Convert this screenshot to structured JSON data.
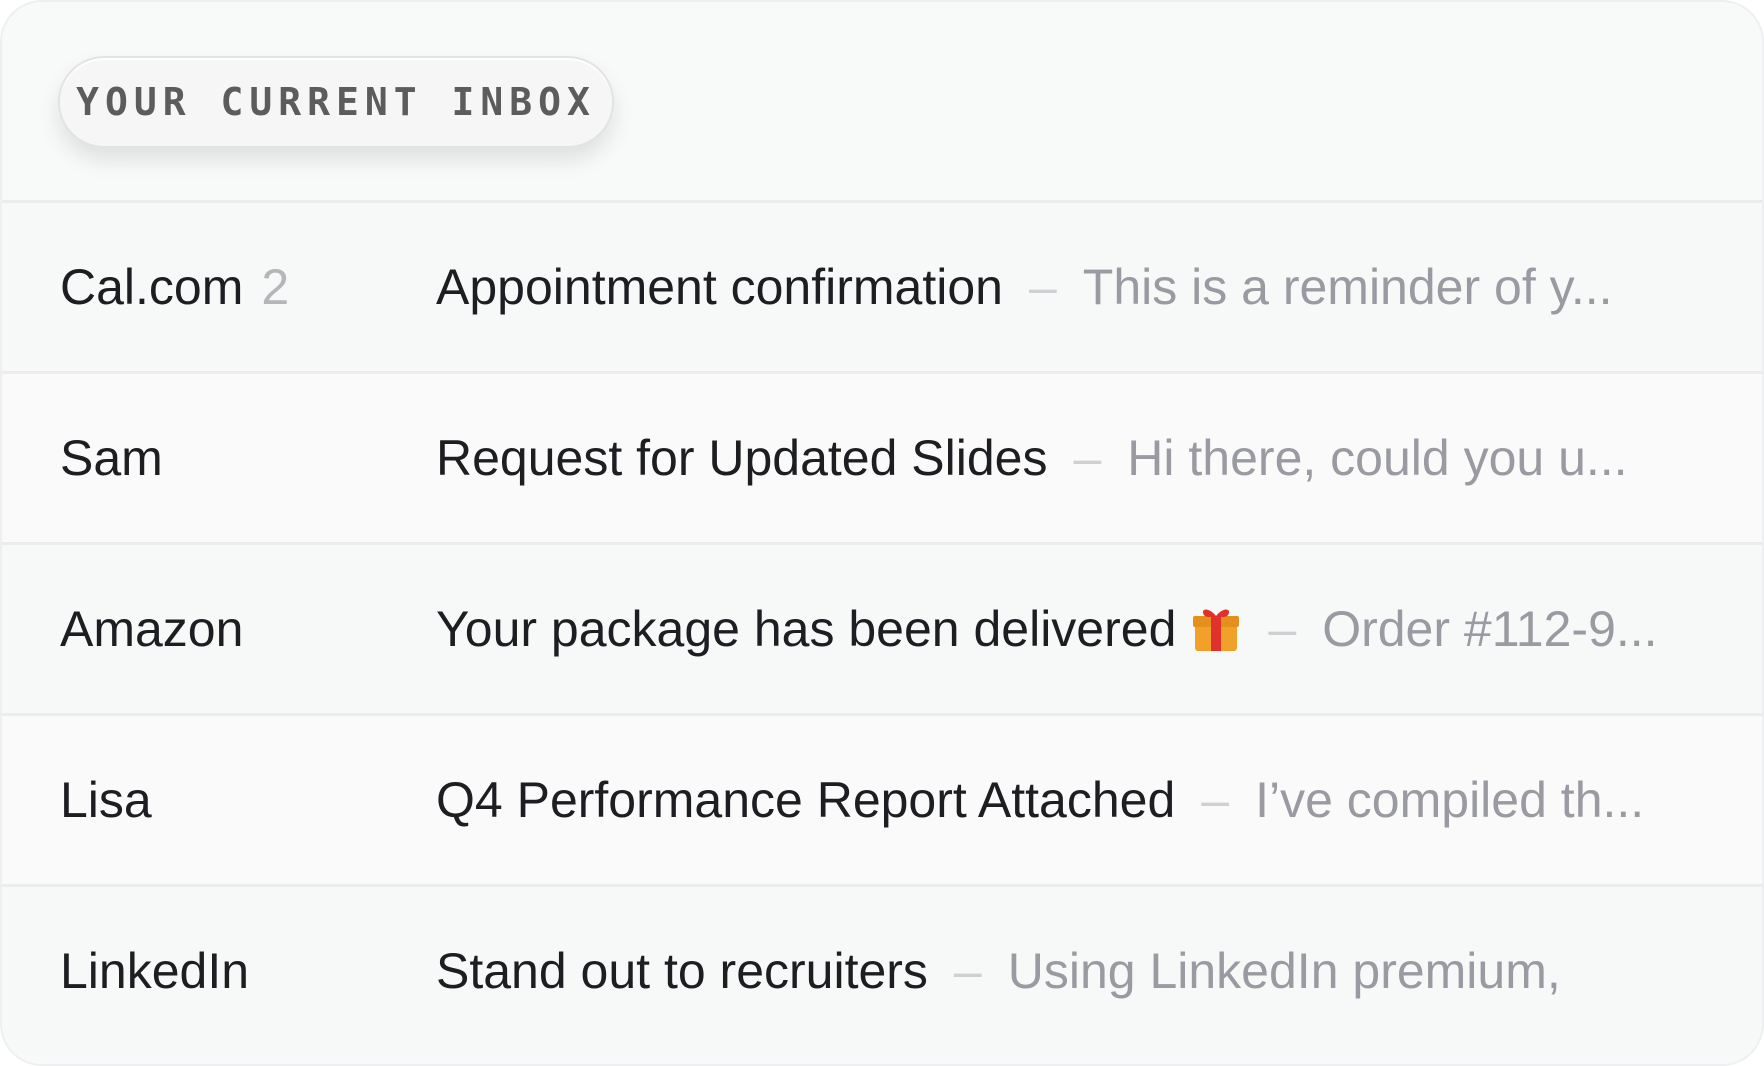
{
  "header": {
    "label": "YOUR CURRENT INBOX"
  },
  "emails": [
    {
      "sender": "Cal.com",
      "count": "2",
      "subject": "Appointment confirmation",
      "dash": "–",
      "preview": "This is a reminder of y..."
    },
    {
      "sender": "Sam",
      "subject": "Request for Updated Slides",
      "dash": "–",
      "preview": "Hi there, could you u..."
    },
    {
      "sender": "Amazon",
      "subject": "Your package has been delivered",
      "icon": "gift-icon",
      "dash": "–",
      "preview": "Order #112-9..."
    },
    {
      "sender": "Lisa",
      "subject": "Q4 Performance Report Attached",
      "dash": "–",
      "preview": "I’ve compiled th..."
    },
    {
      "sender": "LinkedIn",
      "subject": "Stand out to recruiters",
      "dash": "–",
      "preview": "Using LinkedIn premium,"
    }
  ],
  "colors": {
    "text_primary": "#1d1e22",
    "text_muted": "#9a9ba2",
    "count": "#b6b6ba",
    "gift_red": "#e0312c",
    "gift_gold": "#f1a12a"
  }
}
